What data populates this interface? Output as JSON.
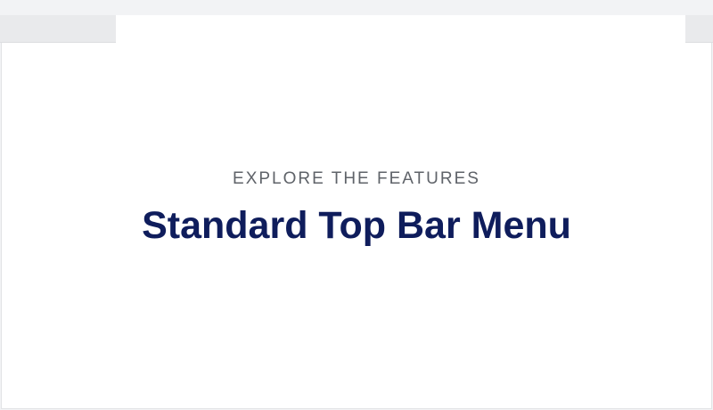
{
  "hero": {
    "eyebrow": "EXPLORE THE FEATURES",
    "title": "Standard Top Bar Menu"
  },
  "colors": {
    "eyebrow": "#5f6369",
    "title": "#0f1d5c",
    "background": "#ffffff",
    "chrome": "#e9eaec"
  }
}
